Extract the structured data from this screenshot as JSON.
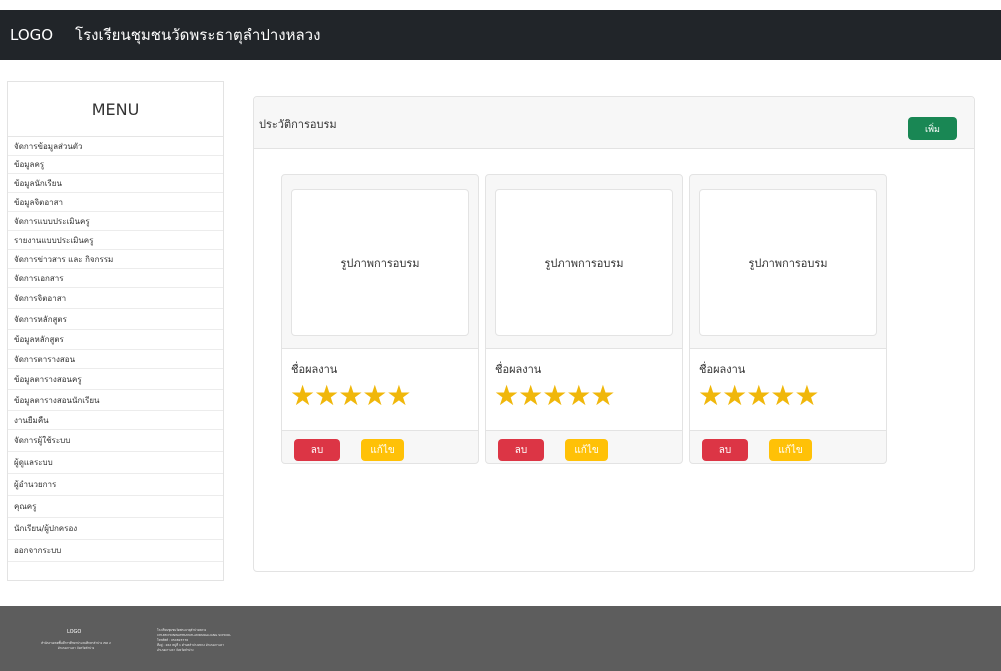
{
  "navbar": {
    "logo": "LOGO",
    "school_name": "โรงเรียนชุมชนวัดพระธาตุลำปางหลวง"
  },
  "sidebar": {
    "title": "MENU",
    "items": [
      "จัดการข้อมูลส่วนตัว",
      "ข้อมูลครู",
      "ข้อมูลนักเรียน",
      "ข้อมูลจิตอาสา",
      "จัดการแบบประเมินครู",
      "รายงานแบบประเมินครู",
      "จัดการข่าวสาร และ กิจกรรม",
      "จัดการเอกสาร",
      "จัดการจิตอาสา",
      "จัดการหลักสูตร",
      "ข้อมูลหลักสูตร",
      "จัดการตารางสอน",
      "ข้อมูลตารางสอนครู",
      "ข้อมูลตารางสอนนักเรียน",
      "งานยืมคืน",
      "จัดการผู้ใช้ระบบ",
      "ผู้ดูแลระบบ",
      "ผู้อำนวยการ",
      "คุณครู",
      "นักเรียน/ผู้ปกครอง",
      "ออกจากระบบ"
    ]
  },
  "panel": {
    "title": "ประวัติการอบรม",
    "add_label": "เพิ่ม",
    "cards": [
      {
        "image_label": "รูปภาพการอบรม",
        "work_name": "ชื่อผลงาน",
        "rating": 5,
        "delete_label": "ลบ",
        "edit_label": "แก้ไข"
      },
      {
        "image_label": "รูปภาพการอบรม",
        "work_name": "ชื่อผลงาน",
        "rating": 5,
        "delete_label": "ลบ",
        "edit_label": "แก้ไข"
      },
      {
        "image_label": "รูปภาพการอบรม",
        "work_name": "ชื่อผลงาน",
        "rating": 5,
        "delete_label": "ลบ",
        "edit_label": "แก้ไข"
      }
    ]
  },
  "footer": {
    "logo": "LOGO",
    "left_text": [
      "สำนักงานเขตพื้นที่การศึกษาประถมศึกษาลำปาง เขต 2",
      "อำเภอเกาะคา จังหวัดลำปาง"
    ],
    "right_text": [
      "โรงเรียนชุมชนวัดพระธาตุลำปางหลวง",
      "CHUMCHONWATPRATATLAMPANGLUANG SCHOOL",
      "โทรศัพท์ : 054823776",
      "ที่อยู่ : 262 หมู่ที่ 1 ตำบลลำปางหลวง อำเภอเกาะคา",
      "อำเภอเกาะคา จังหวัดลำปาง"
    ]
  },
  "colors": {
    "navbar": "#212529",
    "add": "#198754",
    "delete": "#dc3545",
    "edit": "#ffc107",
    "star": "#f0b70b",
    "footer": "#5d5d5d"
  }
}
